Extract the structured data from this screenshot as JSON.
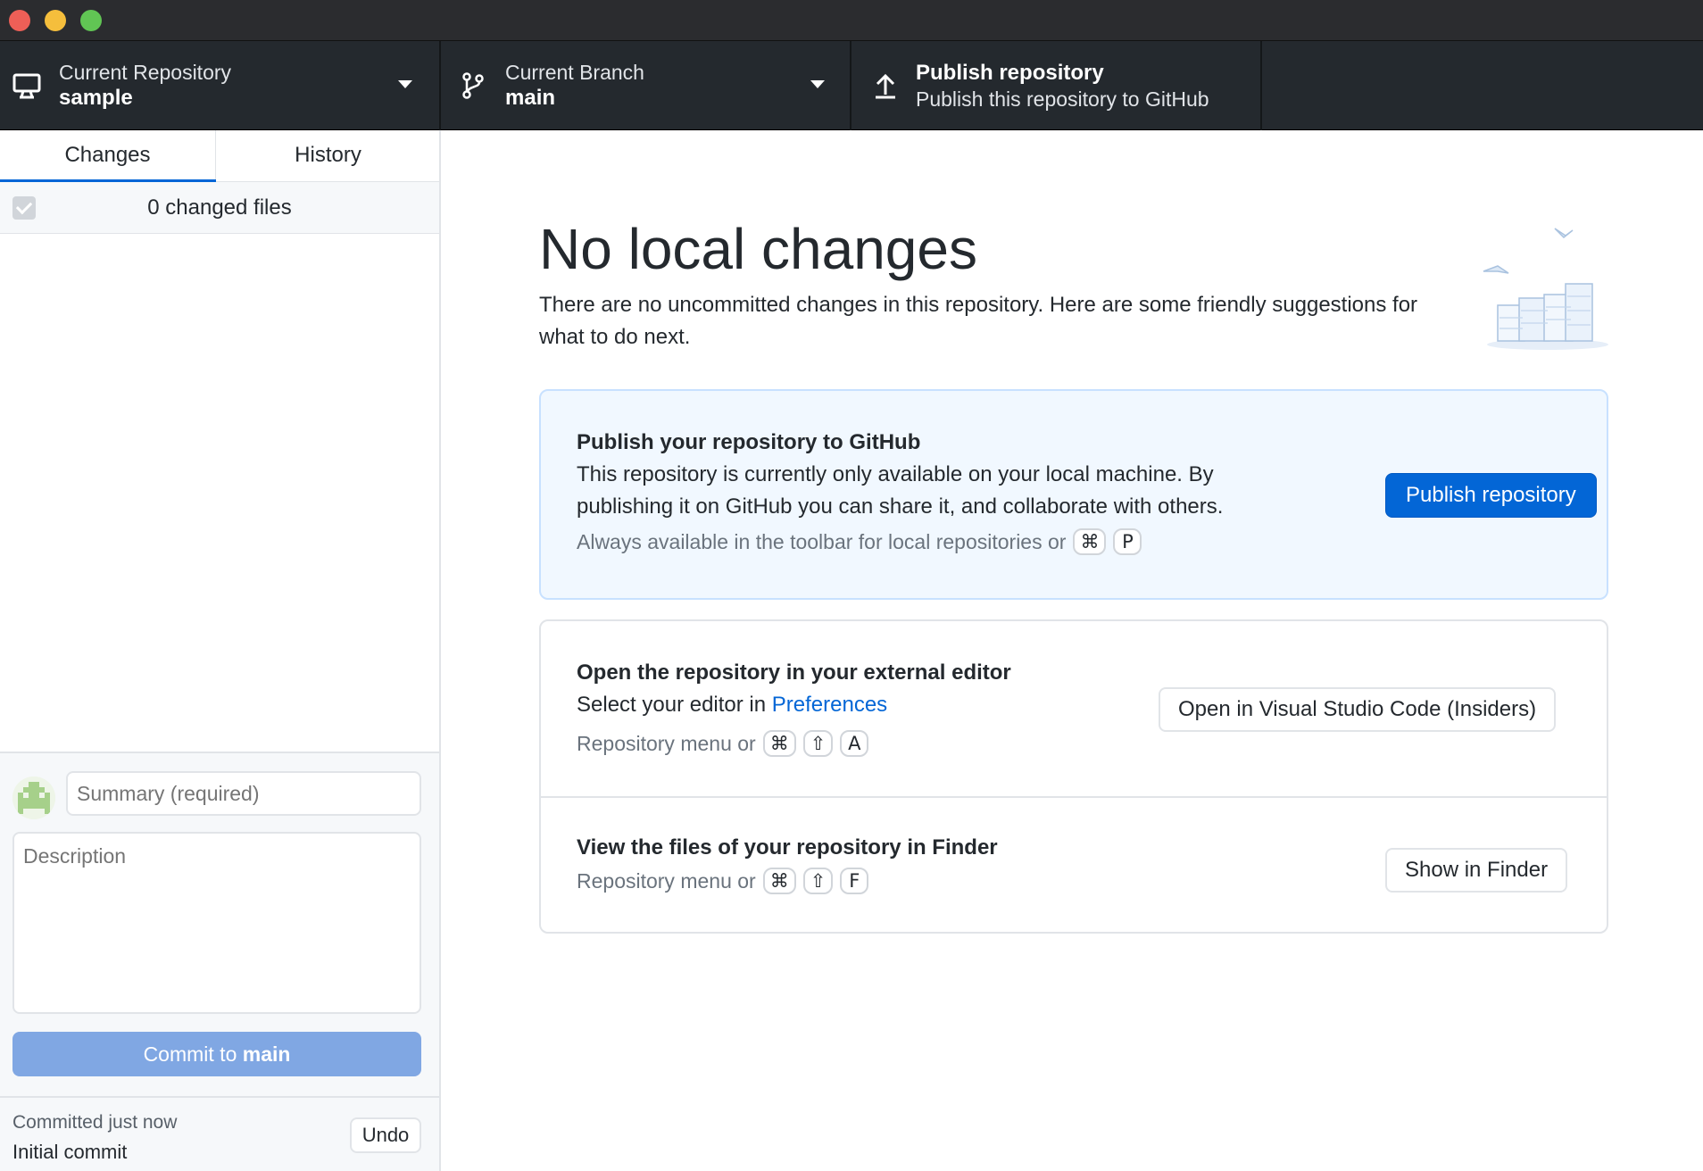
{
  "window": {
    "controls": [
      "close",
      "minimize",
      "zoom"
    ]
  },
  "toolbar": {
    "repository": {
      "label": "Current Repository",
      "value": "sample",
      "icon": "desktop-icon"
    },
    "branch": {
      "label": "Current Branch",
      "value": "main",
      "icon": "git-branch-icon"
    },
    "publish": {
      "title": "Publish repository",
      "subtitle": "Publish this repository to GitHub",
      "icon": "upload-icon"
    }
  },
  "sidebar": {
    "tabs": [
      {
        "label": "Changes",
        "selected": true
      },
      {
        "label": "History",
        "selected": false
      }
    ],
    "files_header": "0 changed files",
    "commit": {
      "summary_placeholder": "Summary (required)",
      "description_placeholder": "Description",
      "button_prefix": "Commit to ",
      "button_branch": "main"
    },
    "last_commit": {
      "when": "Committed just now",
      "message": "Initial commit",
      "undo_label": "Undo"
    }
  },
  "main": {
    "heading": "No local changes",
    "intro": "There are no uncommitted changes in this repository. Here are some friendly suggestions for what to do next.",
    "publish_card": {
      "title": "Publish your repository to GitHub",
      "text": "This repository is currently only available on your local machine. By publishing it on GitHub you can share it, and collaborate with others.",
      "hint": "Always available in the toolbar for local repositories or",
      "keys": [
        "⌘",
        "P"
      ],
      "button": "Publish repository"
    },
    "editor_card": {
      "title": "Open the repository in your external editor",
      "text_prefix": "Select your editor in",
      "link": "Preferences",
      "hint": "Repository menu or",
      "keys": [
        "⌘",
        "⇧",
        "A"
      ],
      "button": "Open in Visual Studio Code (Insiders)"
    },
    "finder_card": {
      "title": "View the files of your repository in Finder",
      "hint": "Repository menu or",
      "keys": [
        "⌘",
        "⇧",
        "F"
      ],
      "button": "Show in Finder"
    }
  },
  "colors": {
    "toolbar_bg": "#24292e",
    "accent": "#0366d6",
    "commit_button_disabled": "#80a7e3",
    "publish_card_bg": "#f1f8ff"
  }
}
